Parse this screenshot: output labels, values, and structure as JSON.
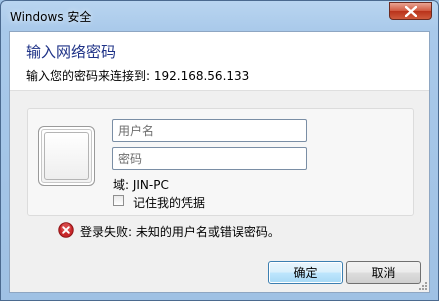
{
  "window": {
    "title": "Windows 安全"
  },
  "header": {
    "title": "输入网络密码",
    "subtitle": "输入您的密码来连接到: 192.168.56.133"
  },
  "credentials": {
    "username_placeholder": "用户名",
    "password_placeholder": "密码",
    "domain_text": "域: JIN-PC",
    "remember_label": "记住我的凭据",
    "remember_checked": false
  },
  "error": {
    "message": "登录失败: 未知的用户名或错误密码。",
    "color": "#c8272a"
  },
  "buttons": {
    "ok_label": "确定",
    "cancel_label": "取消"
  },
  "icons": {
    "close": "close-icon",
    "user_tile": "user-tile-icon",
    "error": "error-icon",
    "checkbox": "checkbox-icon"
  }
}
